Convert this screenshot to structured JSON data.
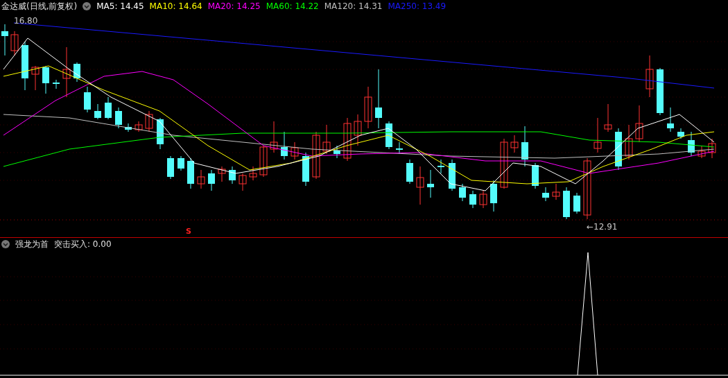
{
  "header": {
    "title": "金达威(日线,前复权)",
    "indicators": [
      {
        "label": "MA5: 14.45",
        "color": "#ffffff"
      },
      {
        "label": "MA10: 14.64",
        "color": "#ffff00"
      },
      {
        "label": "MA20: 14.25",
        "color": "#ff00ff"
      },
      {
        "label": "MA60: 14.22",
        "color": "#00ff00"
      },
      {
        "label": "MA120: 14.31",
        "color": "#c0c0c0"
      },
      {
        "label": "MA250: 13.49",
        "color": "#1a1aff"
      }
    ]
  },
  "price_chart": {
    "high_label": "16.80",
    "low_label": "←12.91",
    "signal_label": "S"
  },
  "indicator_panel": {
    "title": "强龙为首",
    "reading": "突击买入: 0.00"
  }
}
